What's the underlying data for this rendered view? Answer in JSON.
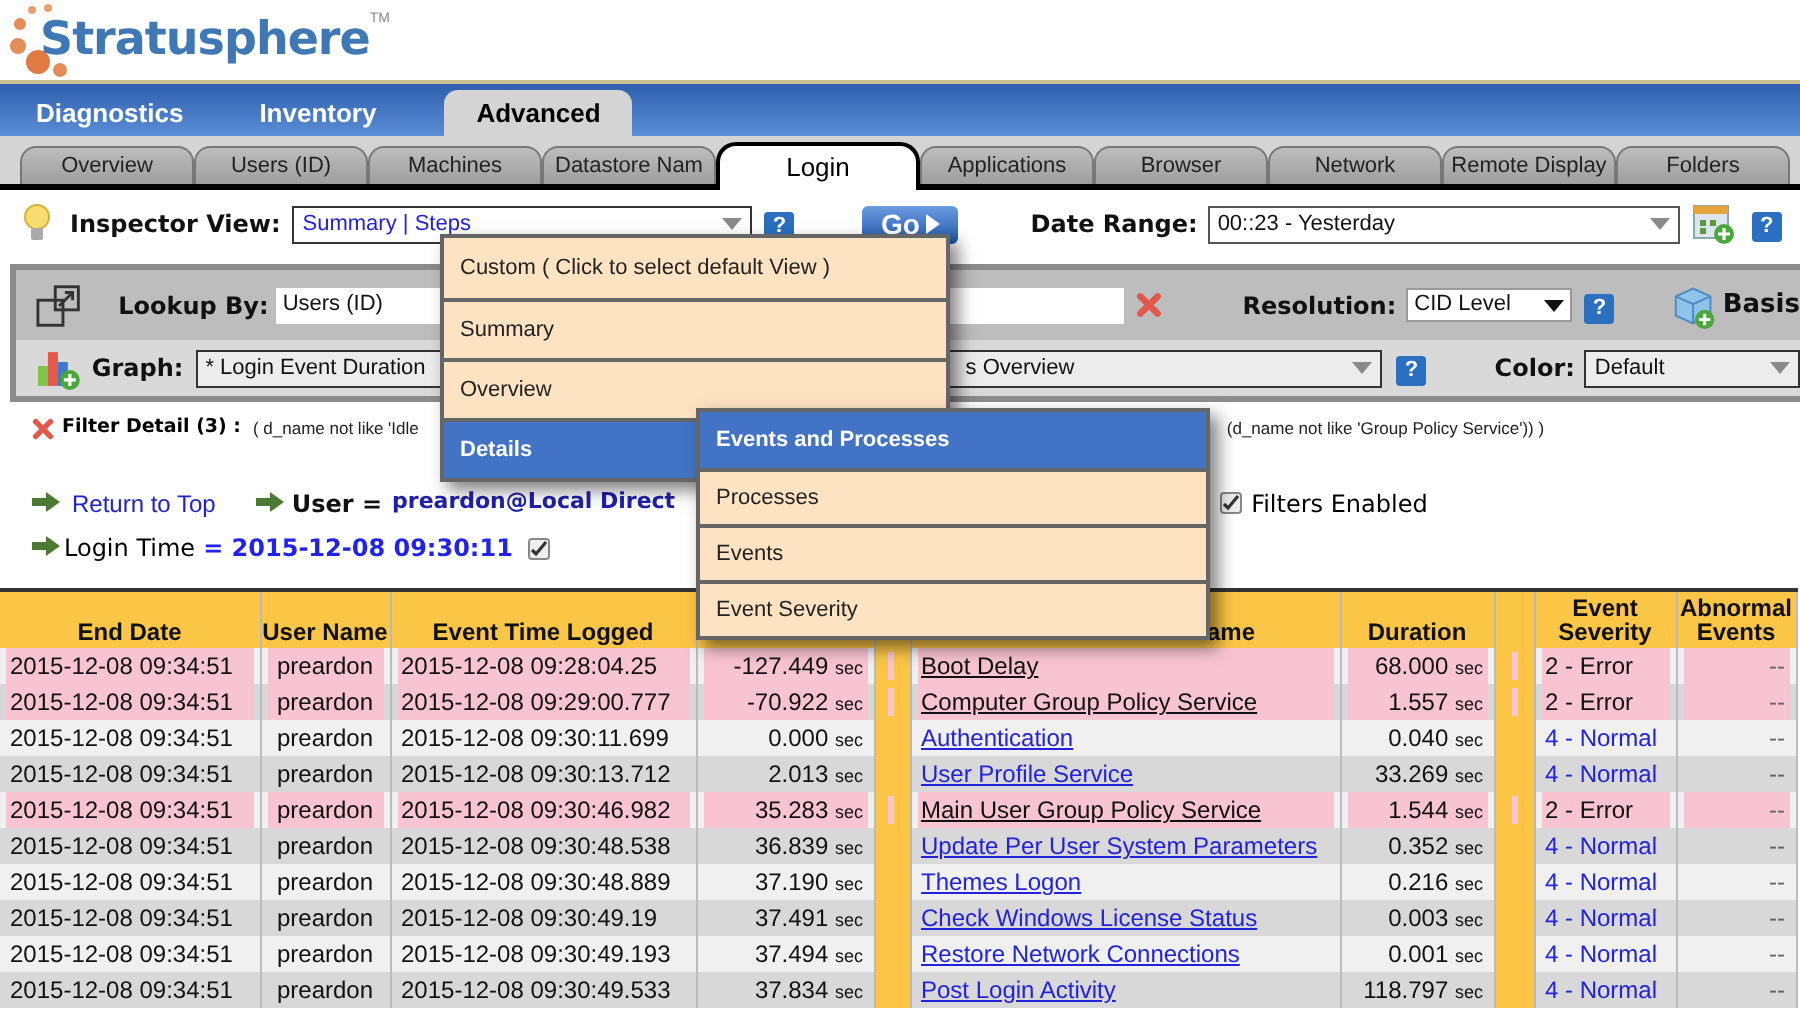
{
  "logo": {
    "name": "Stratusphere",
    "mark": "TM"
  },
  "main_tabs": [
    {
      "label": "Diagnostics",
      "selected": false
    },
    {
      "label": "Inventory",
      "selected": false
    },
    {
      "label": "Advanced",
      "selected": true
    }
  ],
  "sub_tabs": [
    {
      "label": "Overview",
      "selected": false
    },
    {
      "label": "Users (ID)",
      "selected": false
    },
    {
      "label": "Machines",
      "selected": false
    },
    {
      "label": "Datastore Nam",
      "selected": false
    },
    {
      "label": "Login",
      "selected": true
    },
    {
      "label": "Applications",
      "selected": false
    },
    {
      "label": "Browser",
      "selected": false
    },
    {
      "label": "Network",
      "selected": false
    },
    {
      "label": "Remote Display",
      "selected": false
    },
    {
      "label": "Folders",
      "selected": false
    }
  ],
  "inspector_view": {
    "label": "Inspector View:",
    "value": "Summary | Steps",
    "help": "?"
  },
  "go_button": "Go",
  "date_range": {
    "label": "Date Range:",
    "value": "00::23 - Yesterday",
    "help": "?"
  },
  "lookup": {
    "label": "Lookup By:",
    "value": "Users (ID)"
  },
  "resolution": {
    "label": "Resolution:",
    "value": "CID Level",
    "help": "?"
  },
  "basis": "Basis",
  "graph": {
    "label": "Graph:",
    "value": "* Login Event Duration",
    "value_tail": "s Overview",
    "help": "?"
  },
  "color": {
    "label": "Color:",
    "value": "Default"
  },
  "filter_detail": {
    "label": "Filter Detail (3) :",
    "text_start": "( d_name not like 'Idle",
    "text_end": "(d_name not like 'Group Policy Service')) )"
  },
  "return_link": "Return to Top",
  "user": {
    "label": "User =",
    "value": "preardon@Local Direct"
  },
  "filters_enabled": {
    "label": "Filters Enabled",
    "checked": true
  },
  "login_time": {
    "label": "Login Time",
    "value": "= 2015-12-08 09:30:11",
    "checked": true
  },
  "view_menu": [
    {
      "label": "Custom ( Click to select default View )",
      "selected": false
    },
    {
      "label": "Summary",
      "selected": false
    },
    {
      "label": "Overview",
      "selected": false
    },
    {
      "label": "Details",
      "selected": true
    }
  ],
  "submenu": [
    {
      "label": "Events and Processes",
      "selected": true
    },
    {
      "label": "Processes",
      "selected": false
    },
    {
      "label": "Events",
      "selected": false
    },
    {
      "label": "Event Severity",
      "selected": false
    }
  ],
  "table": {
    "columns": [
      "End Date",
      "User Name",
      "Event Time Logged",
      "ame",
      "Duration",
      "Event Severity",
      "Abnormal Events"
    ],
    "rows": [
      {
        "end_date": "2015-12-08 09:34:51",
        "user": "preardon",
        "logged": "2015-12-08 09:28:04.25",
        "offset": {
          "value": "-127.449",
          "unit": "sec"
        },
        "event": "Boot Delay",
        "duration": {
          "value": "68.000",
          "unit": "sec"
        },
        "severity": "2 - Error",
        "abnormal": "--",
        "flagged": true
      },
      {
        "end_date": "2015-12-08 09:34:51",
        "user": "preardon",
        "logged": "2015-12-08 09:29:00.777",
        "offset": {
          "value": "-70.922",
          "unit": "sec"
        },
        "event": "Computer Group Policy Service",
        "duration": {
          "value": "1.557",
          "unit": "sec"
        },
        "severity": "2 - Error",
        "abnormal": "--",
        "flagged": true
      },
      {
        "end_date": "2015-12-08 09:34:51",
        "user": "preardon",
        "logged": "2015-12-08 09:30:11.699",
        "offset": {
          "value": "0.000",
          "unit": "sec"
        },
        "event": "Authentication",
        "duration": {
          "value": "0.040",
          "unit": "sec"
        },
        "severity": "4 - Normal",
        "abnormal": "--",
        "flagged": false
      },
      {
        "end_date": "2015-12-08 09:34:51",
        "user": "preardon",
        "logged": "2015-12-08 09:30:13.712",
        "offset": {
          "value": "2.013",
          "unit": "sec"
        },
        "event": "User Profile Service",
        "duration": {
          "value": "33.269",
          "unit": "sec"
        },
        "severity": "4 - Normal",
        "abnormal": "--",
        "flagged": false
      },
      {
        "end_date": "2015-12-08 09:34:51",
        "user": "preardon",
        "logged": "2015-12-08 09:30:46.982",
        "offset": {
          "value": "35.283",
          "unit": "sec"
        },
        "event": "Main User Group Policy Service",
        "duration": {
          "value": "1.544",
          "unit": "sec"
        },
        "severity": "2 - Error",
        "abnormal": "--",
        "flagged": true
      },
      {
        "end_date": "2015-12-08 09:34:51",
        "user": "preardon",
        "logged": "2015-12-08 09:30:48.538",
        "offset": {
          "value": "36.839",
          "unit": "sec"
        },
        "event": "Update Per User System Parameters",
        "duration": {
          "value": "0.352",
          "unit": "sec"
        },
        "severity": "4 - Normal",
        "abnormal": "--",
        "flagged": false
      },
      {
        "end_date": "2015-12-08 09:34:51",
        "user": "preardon",
        "logged": "2015-12-08 09:30:48.889",
        "offset": {
          "value": "37.190",
          "unit": "sec"
        },
        "event": "Themes Logon",
        "duration": {
          "value": "0.216",
          "unit": "sec"
        },
        "severity": "4 - Normal",
        "abnormal": "--",
        "flagged": false
      },
      {
        "end_date": "2015-12-08 09:34:51",
        "user": "preardon",
        "logged": "2015-12-08 09:30:49.19",
        "offset": {
          "value": "37.491",
          "unit": "sec"
        },
        "event": "Check Windows License Status",
        "duration": {
          "value": "0.003",
          "unit": "sec"
        },
        "severity": "4 - Normal",
        "abnormal": "--",
        "flagged": false
      },
      {
        "end_date": "2015-12-08 09:34:51",
        "user": "preardon",
        "logged": "2015-12-08 09:30:49.193",
        "offset": {
          "value": "37.494",
          "unit": "sec"
        },
        "event": "Restore Network Connections",
        "duration": {
          "value": "0.001",
          "unit": "sec"
        },
        "severity": "4 - Normal",
        "abnormal": "--",
        "flagged": false
      },
      {
        "end_date": "2015-12-08 09:34:51",
        "user": "preardon",
        "logged": "2015-12-08 09:30:49.533",
        "offset": {
          "value": "37.834",
          "unit": "sec"
        },
        "event": "Post Login Activity",
        "duration": {
          "value": "118.797",
          "unit": "sec"
        },
        "severity": "4 - Normal",
        "abnormal": "--",
        "flagged": false
      }
    ]
  }
}
